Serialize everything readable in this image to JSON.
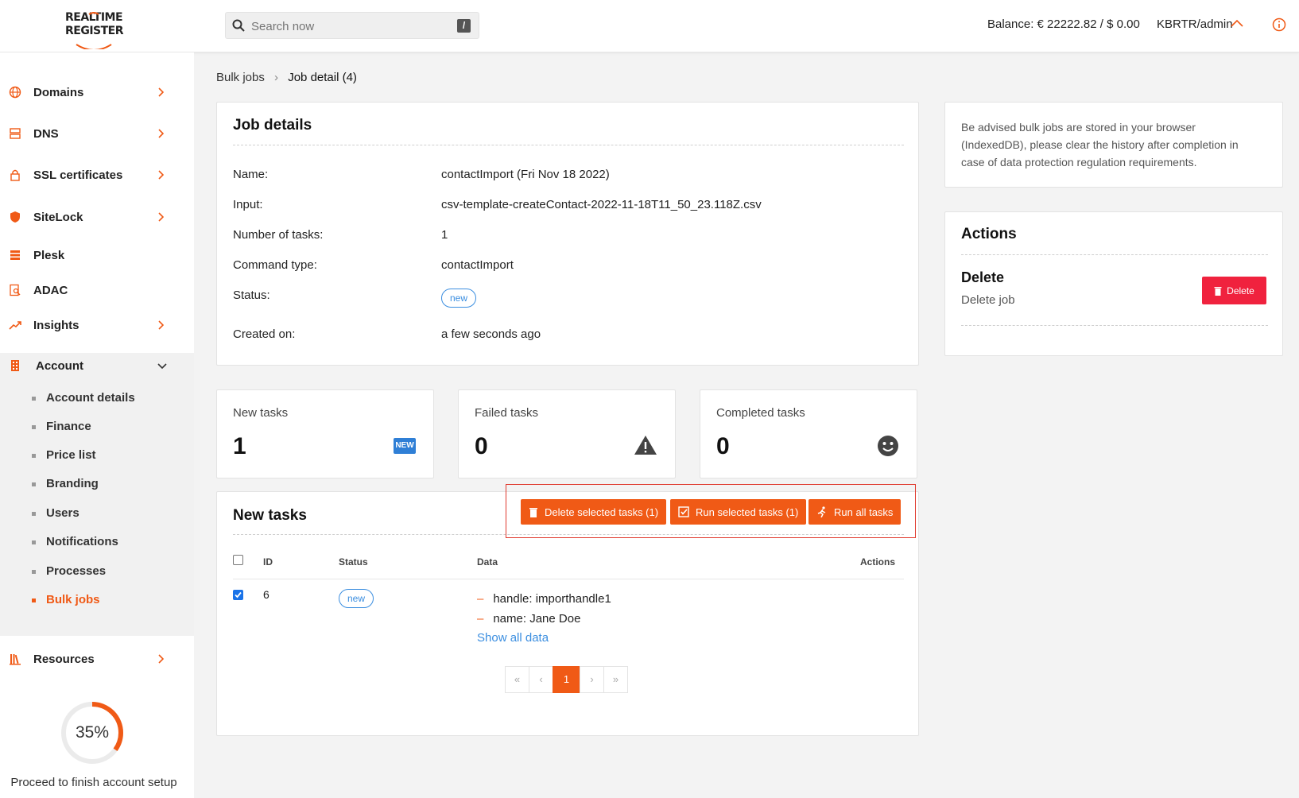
{
  "header": {
    "logo_line1": "REALTIME",
    "logo_line2": "REGISTER",
    "search_placeholder": "Search now",
    "search_shortcut": "/",
    "balance": "Balance: € 22222.82 / $ 0.00",
    "user": "KBRTR/admin"
  },
  "sidebar": {
    "items": [
      {
        "label": "Domains",
        "icon": "globe-icon"
      },
      {
        "label": "DNS",
        "icon": "server-icon"
      },
      {
        "label": "SSL certificates",
        "icon": "lock-icon"
      },
      {
        "label": "SiteLock",
        "icon": "shield-icon"
      },
      {
        "label": "Plesk",
        "icon": "stack-icon"
      },
      {
        "label": "ADAC",
        "icon": "document-search-icon"
      },
      {
        "label": "Insights",
        "icon": "trend-icon"
      },
      {
        "label": "Account",
        "icon": "building-icon"
      },
      {
        "label": "Resources",
        "icon": "books-icon"
      }
    ],
    "account_subitems": [
      "Account details",
      "Finance",
      "Price list",
      "Branding",
      "Users",
      "Notifications",
      "Processes",
      "Bulk jobs"
    ],
    "active_subitem": "Bulk jobs",
    "progress": {
      "value": 35,
      "label": "35%"
    },
    "setup_text": "Proceed to finish account setup"
  },
  "breadcrumb": {
    "parent": "Bulk jobs",
    "separator": "›",
    "current": "Job detail (4)"
  },
  "job_details": {
    "title": "Job details",
    "rows": [
      {
        "label": "Name:",
        "value": "contactImport (Fri Nov 18 2022)"
      },
      {
        "label": "Input:",
        "value": "csv-template-createContact-2022-11-18T11_50_23.118Z.csv"
      },
      {
        "label": "Number of tasks:",
        "value": "1"
      },
      {
        "label": "Command type:",
        "value": "contactImport"
      },
      {
        "label": "Status:",
        "value": "new"
      },
      {
        "label": "Created on:",
        "value": "a few seconds ago"
      }
    ]
  },
  "stats": [
    {
      "label": "New tasks",
      "value": "1",
      "icon": "new-badge-icon",
      "icon_text": "NEW"
    },
    {
      "label": "Failed tasks",
      "value": "0",
      "icon": "warning-icon"
    },
    {
      "label": "Completed tasks",
      "value": "0",
      "icon": "smiley-icon"
    }
  ],
  "tasks": {
    "title": "New tasks",
    "buttons": {
      "delete_selected": "Delete selected tasks (1)",
      "run_selected": "Run selected tasks (1)",
      "run_all": "Run all tasks"
    },
    "columns": [
      "ID",
      "Status",
      "Data",
      "Actions"
    ],
    "rows": [
      {
        "checked": true,
        "id": "6",
        "status": "new",
        "data": [
          "handle: importhandle1",
          "name: Jane Doe"
        ],
        "show_all": "Show all data"
      }
    ],
    "pagination": {
      "first": "«",
      "prev": "‹",
      "current": "1",
      "next": "›",
      "last": "»"
    }
  },
  "notice": {
    "text": "Be advised bulk jobs are stored in your browser (IndexedDB), please clear the history after completion in case of data protection regulation requirements."
  },
  "actions": {
    "title": "Actions",
    "delete_heading": "Delete",
    "delete_desc": "Delete job",
    "delete_button": "Delete"
  },
  "colors": {
    "accent": "#f05a16",
    "danger": "#f0223e",
    "link": "#3b8ee0"
  }
}
